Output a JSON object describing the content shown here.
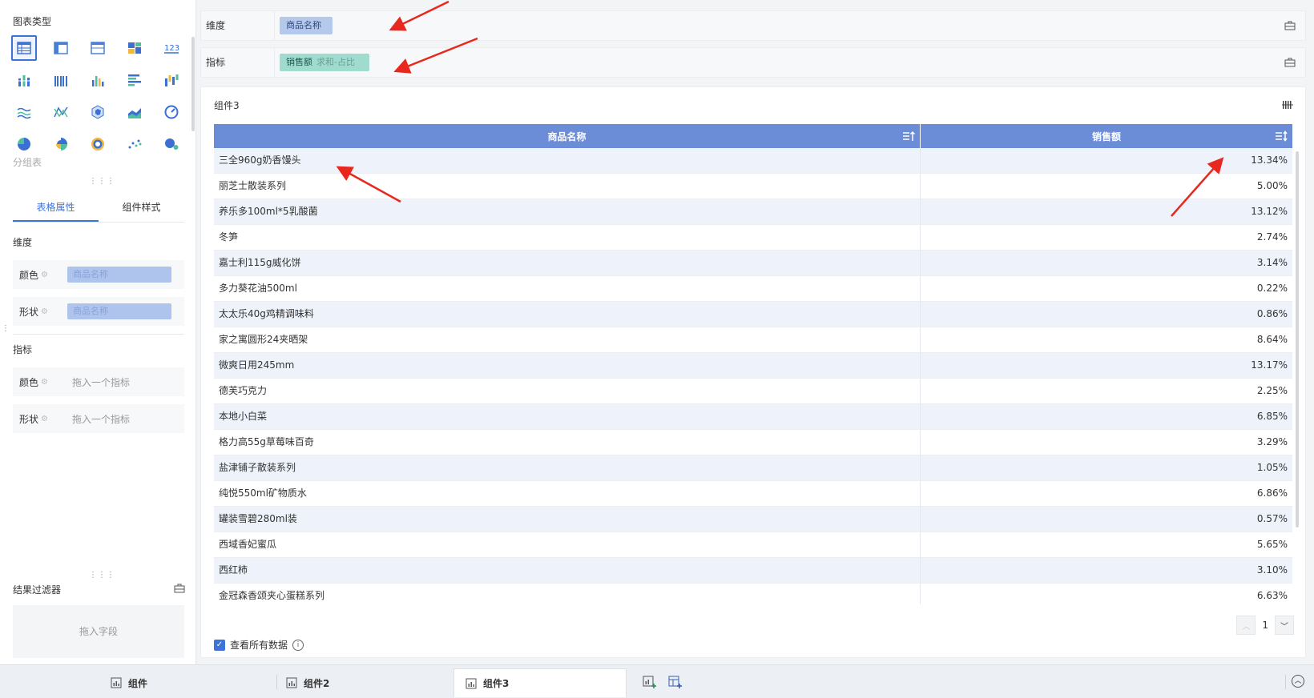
{
  "left_panel": {
    "chart_type_title": "图表类型",
    "chart_type_hint": "分组表",
    "tabs": [
      "表格属性",
      "组件样式"
    ],
    "dimension_title": "维度",
    "metric_title": "指标",
    "dim_props": [
      {
        "label": "颜色",
        "chip": "商品名称"
      },
      {
        "label": "形状",
        "chip": "商品名称"
      }
    ],
    "metric_props": [
      {
        "label": "颜色",
        "placeholder": "拖入一个指标"
      },
      {
        "label": "形状",
        "placeholder": "拖入一个指标"
      }
    ],
    "filter_title": "结果过滤器",
    "filter_drop": "拖入字段"
  },
  "fields": {
    "dimension_label": "维度",
    "dimension_chip": "商品名称",
    "metric_label": "指标",
    "metric_chip": "销售额",
    "metric_chip_sub": "求和-占比"
  },
  "card": {
    "title": "组件3",
    "columns": [
      "商品名称",
      "销售额"
    ],
    "rows": [
      [
        "三全960g奶香馒头",
        "13.34%"
      ],
      [
        "丽芝士散装系列",
        "5.00%"
      ],
      [
        "养乐多100ml*5乳酸菌",
        "13.12%"
      ],
      [
        "冬笋",
        "2.74%"
      ],
      [
        "嘉士利115g威化饼",
        "3.14%"
      ],
      [
        "多力葵花油500ml",
        "0.22%"
      ],
      [
        "太太乐40g鸡精调味料",
        "0.86%"
      ],
      [
        "家之寓圆形24夹晒架",
        "8.64%"
      ],
      [
        "微爽日用245mm",
        "13.17%"
      ],
      [
        "德芙巧克力",
        "2.25%"
      ],
      [
        "本地小白菜",
        "6.85%"
      ],
      [
        "格力高55g草莓味百奇",
        "3.29%"
      ],
      [
        "盐津铺子散装系列",
        "1.05%"
      ],
      [
        "纯悦550ml矿物质水",
        "6.86%"
      ],
      [
        "罐装雪碧280ml装",
        "0.57%"
      ],
      [
        "西域香妃蜜瓜",
        "5.65%"
      ],
      [
        "西红柿",
        "3.10%"
      ],
      [
        "金冠森香颂夹心蛋糕系列",
        "6.63%"
      ]
    ],
    "page": "1",
    "view_all": "查看所有数据"
  },
  "bottom_tabs": [
    "组件",
    "组件2",
    "组件3"
  ],
  "colors": {
    "accent": "#3d73d6",
    "header": "#6b8cd6",
    "dim_chip": "#b5c9ed",
    "metric_chip": "#9fdccf",
    "annotation": "#e8281e"
  }
}
